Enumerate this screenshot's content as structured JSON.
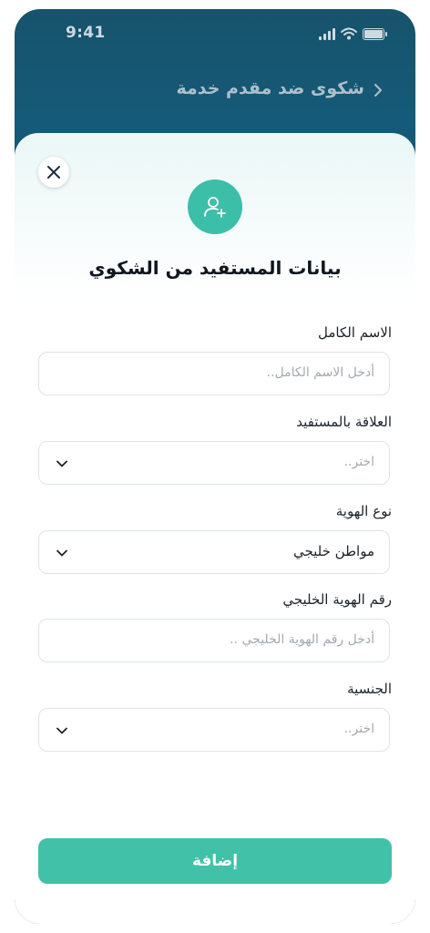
{
  "status_bar": {
    "time": "9:41"
  },
  "header": {
    "title": "شكوى ضد مقدم خدمة"
  },
  "sheet": {
    "title": "بيانات المستفيد من الشكوي",
    "fields": [
      {
        "label": "الاسم الكامل",
        "placeholder": "أدخل الاسم الكامل..",
        "value": ""
      },
      {
        "label": "العلاقة بالمستفيد",
        "placeholder": "اختر..",
        "value": ""
      },
      {
        "label": "نوع الهوية",
        "placeholder": "",
        "value": "مواطن خليجي"
      },
      {
        "label": "رقم الهوية الخليجي",
        "placeholder": "أدخل رقم الهوية الخليجي ..",
        "value": ""
      },
      {
        "label": "الجنسية",
        "placeholder": "اختر..",
        "value": ""
      }
    ],
    "submit_label": "إضافة"
  },
  "colors": {
    "accent": "#41c2a8",
    "background_top": "#17536b",
    "background_bottom": "#101f5e"
  },
  "icons": [
    "close-icon",
    "add-user-icon",
    "chevron-left-icon",
    "chevron-down-icon",
    "wifi-icon",
    "signal-icon",
    "battery-icon"
  ]
}
